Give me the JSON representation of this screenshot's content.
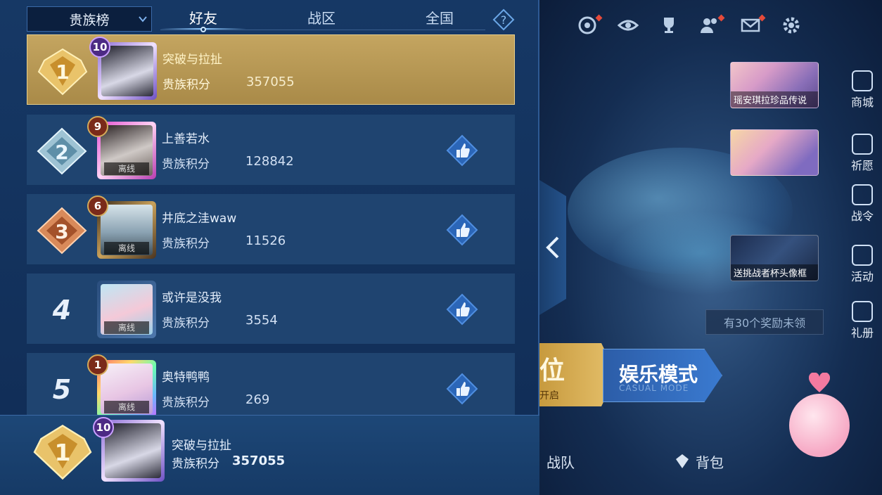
{
  "panel": {
    "dropdown_label": "贵族榜",
    "tabs": [
      {
        "label": "好友",
        "active": true
      },
      {
        "label": "战区",
        "active": false
      },
      {
        "label": "全国",
        "active": false
      }
    ],
    "help_icon": "help-icon",
    "score_label": "贵族积分",
    "offline_label": "离线",
    "rows": [
      {
        "rank": "1",
        "level": "10",
        "name": "突破与拉扯",
        "score": "357055",
        "offline": false,
        "like": false
      },
      {
        "rank": "2",
        "level": "9",
        "name": "上善若水",
        "score": "128842",
        "offline": true,
        "like": true
      },
      {
        "rank": "3",
        "level": "6",
        "name": "井底之洼waw",
        "score": "11526",
        "offline": true,
        "like": true
      },
      {
        "rank": "4",
        "level": "",
        "name": "或许是没我",
        "score": "3554",
        "offline": true,
        "like": true
      },
      {
        "rank": "5",
        "level": "1",
        "name": "奥特鸭鸭",
        "score": "269",
        "offline": true,
        "like": true
      }
    ],
    "self": {
      "rank": "1",
      "level": "10",
      "name": "突破与拉扯",
      "score": "357055"
    }
  },
  "lobby": {
    "top_icons": [
      "radar-icon",
      "eye-icon",
      "trophy-icon",
      "friends-icon",
      "mail-icon",
      "gear-icon"
    ],
    "cards": [
      {
        "caption": "瑶安琪拉珍品传说"
      },
      {
        "caption": ""
      },
      {
        "caption": "送挑战者杯头像框"
      }
    ],
    "side_buttons": [
      "商城",
      "祈愿",
      "战令",
      "活动",
      "礼册"
    ],
    "reward_text": "有30个奖励未领",
    "mode_rank_big": "位",
    "mode_rank_small": "开启",
    "mode_fun_title": "娱乐模式",
    "mode_fun_sub": "CASUAL MODE",
    "bottom_nav": [
      "战队",
      "背包"
    ]
  },
  "colors": {
    "panel_bg": "#163865",
    "row_bg": "#1f4470",
    "gold_row": "#c4a560",
    "accent_blue": "#3b7dd8"
  }
}
